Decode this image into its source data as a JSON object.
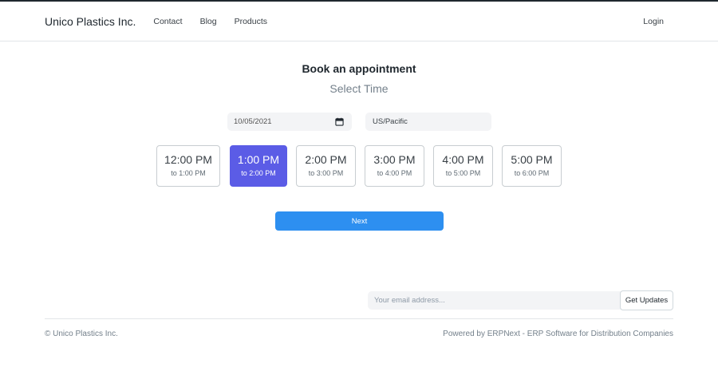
{
  "navbar": {
    "brand": "Unico Plastics Inc.",
    "links": [
      "Contact",
      "Blog",
      "Products"
    ],
    "login": "Login"
  },
  "booking": {
    "title": "Book an appointment",
    "subtitle": "Select Time",
    "date_value": "10/05/2021",
    "timezone": "US/Pacific",
    "selected_slot": 1,
    "slots": [
      {
        "time": "12:00 PM",
        "sub": "to 1:00 PM"
      },
      {
        "time": "1:00 PM",
        "sub": "to 2:00 PM"
      },
      {
        "time": "2:00 PM",
        "sub": "to 3:00 PM"
      },
      {
        "time": "3:00 PM",
        "sub": "to 4:00 PM"
      },
      {
        "time": "4:00 PM",
        "sub": "to 5:00 PM"
      },
      {
        "time": "5:00 PM",
        "sub": "to 6:00 PM"
      }
    ],
    "next_label": "Next"
  },
  "footer": {
    "email_placeholder": "Your email address...",
    "updates_label": "Get Updates",
    "copyright": "© Unico Plastics Inc.",
    "powered_by": "Powered by ERPNext - ERP Software for Distribution Companies"
  },
  "colors": {
    "accent_selected": "#5b5ce6",
    "primary_button": "#2d8ff0"
  },
  "icons": {
    "date_picker": "calendar-icon"
  }
}
